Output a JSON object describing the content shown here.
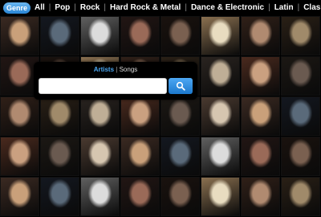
{
  "genre_bar": {
    "genre_button_label": "Genre",
    "genres": [
      "All",
      "Pop",
      "Rock",
      "Hard Rock & Metal",
      "Dance & Electronic",
      "Latin",
      "Classica"
    ]
  },
  "search": {
    "tab_artists": "Artists",
    "tab_divider": "|",
    "tab_songs": "Songs",
    "input_value": "",
    "input_placeholder": "",
    "button_icon": "search-icon"
  },
  "colors": {
    "accent_blue": "#2a86d6",
    "link_blue": "#4aa6f0"
  }
}
